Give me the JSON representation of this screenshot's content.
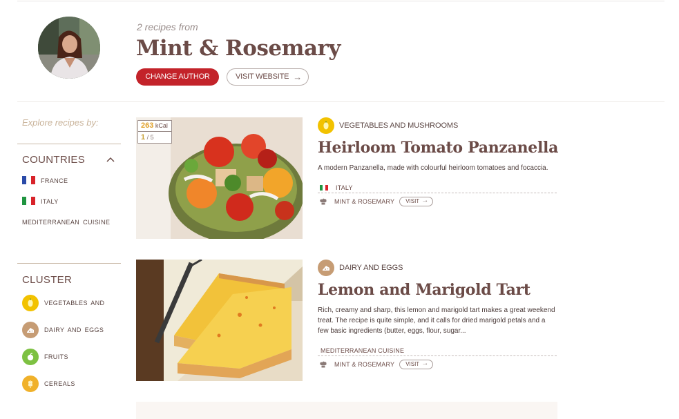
{
  "author": {
    "recipes_count_label": "2 recipes from",
    "name": "Mint & Rosemary",
    "change_author_label": "CHANGE AUTHOR",
    "visit_website_label": "VISIT WEBSITE",
    "arrow_icon": "arrow-right-icon"
  },
  "sidebar": {
    "explore_label": "Explore recipes by:",
    "countries": {
      "heading": "COUNTRIES",
      "toggle_icon": "chevron-up-icon",
      "items": [
        {
          "label": "FRANCE",
          "flag": [
            "#2a4aa8",
            "#ffffff",
            "#d8232a"
          ]
        },
        {
          "label": "ITALY",
          "flag": [
            "#1f9440",
            "#ffffff",
            "#d8232a"
          ]
        }
      ],
      "extra_item": "MEDITERRANEAN CUISINE"
    },
    "cluster": {
      "heading": "CLUSTER",
      "items": [
        {
          "label": "VEGETABLES AND",
          "icon": "pepper-icon",
          "color": "#f2c200"
        },
        {
          "label": "DAIRY AND EGGS",
          "icon": "cheese-icon",
          "color": "#c69c74"
        },
        {
          "label": "FRUITS",
          "icon": "apple-icon",
          "color": "#7dc142"
        },
        {
          "label": "CEREALS",
          "icon": "wheat-icon",
          "color": "#f0b12a"
        }
      ]
    }
  },
  "recipes": [
    {
      "category": "VEGETABLES AND MUSHROOMS",
      "category_icon": "pepper-icon",
      "category_color": "#f2c200",
      "title": "Heirloom Tomato Panzanella",
      "description": "A modern Panzanella, made with colourful heirloom tomatoes and focaccia.",
      "kcal_value": "263",
      "kcal_unit": "kCal",
      "score_value": "1",
      "score_max": "/ 5",
      "country": "ITALY",
      "country_flag": [
        "#1f9440",
        "#ffffff",
        "#d8232a"
      ],
      "author": "MINT & ROSEMARY",
      "visit_label": "VISIT"
    },
    {
      "category": "DAIRY AND EGGS",
      "category_icon": "cheese-icon",
      "category_color": "#c69c74",
      "title": "Lemon and Marigold Tart",
      "description": "Rich, creamy and sharp, this lemon and marigold tart makes a great weekend treat. The recipe is quite simple, and it calls for dried marigold petals and a few basic ingredients (butter, eggs, flour, sugar...",
      "cuisine": "MEDITERRANEAN CUISINE",
      "author": "MINT & ROSEMARY",
      "visit_label": "VISIT"
    }
  ],
  "colors": {
    "brand_red": "#c3232a",
    "text_brown": "#6b4b47",
    "accent_tan": "#c9b39a"
  }
}
